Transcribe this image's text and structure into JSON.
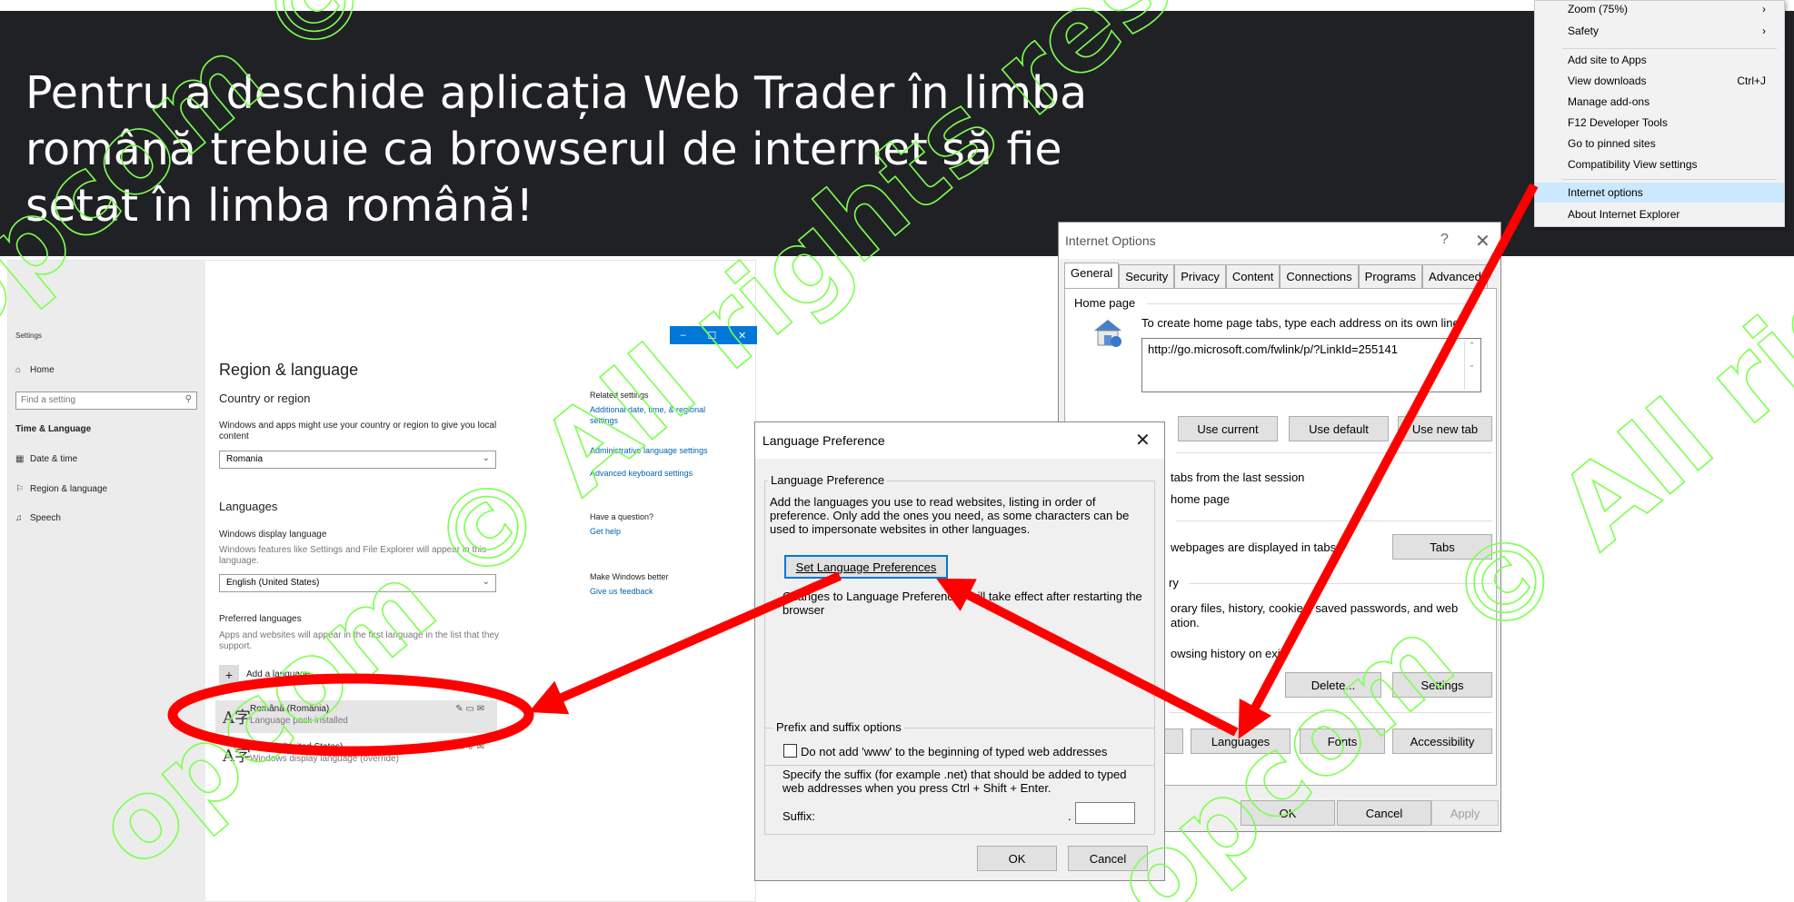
{
  "headline": {
    "line1": "Pentru a deschide aplicația  Web Trader în limba",
    "line2": "română  trebuie ca browserul de internet să fie",
    "line3": "setat în limba română!"
  },
  "settings": {
    "window_title": "Settings",
    "sidebar": {
      "home": "Home",
      "search_placeholder": "Find a setting",
      "section": "Time & Language",
      "items": [
        "Date & time",
        "Region & language",
        "Speech"
      ]
    },
    "window_buttons": {
      "minimize": "–",
      "maximize": "☐",
      "close": "✕"
    },
    "page_title": "Region & language",
    "country_heading": "Country or region",
    "country_desc": "Windows and apps might use your country or region to give you local content",
    "country_value": "Romania",
    "languages_heading": "Languages",
    "display_language_label": "Windows display language",
    "display_language_desc": "Windows features like Settings and File Explorer will appear in this language.",
    "display_language_value": "English (United States)",
    "preferred_label": "Preferred languages",
    "preferred_desc": "Apps and websites will appear in the first language in the list that they support.",
    "add_language": "Add a language",
    "languages": [
      {
        "name": "Română (România)",
        "status": "Language pack installed"
      },
      {
        "name": "English (United States)",
        "status": "Windows display language (override)"
      }
    ],
    "related": {
      "heading": "Related settings",
      "links": [
        "Additional date, time, & regional settings",
        "Administrative language settings",
        "Advanced keyboard settings"
      ],
      "question": "Have a question?",
      "get_help": "Get help",
      "better": "Make Windows better",
      "feedback": "Give us feedback"
    }
  },
  "language_dialog": {
    "title": "Language Preference",
    "group1": "Language Preference",
    "desc": "Add the languages you use to read websites, listing in order of preference. Only add the ones you need, as some characters can be used to impersonate websites in other languages.",
    "set_button": "Set Language Preferences",
    "note": "Changes to Language Preferences will take effect after restarting the browser",
    "group2": "Prefix and suffix options",
    "checkbox": "Do not add 'www' to the beginning of typed web addresses",
    "suffix_desc": "Specify the suffix (for example .net) that should be added to typed web addresses when you press Ctrl + Shift + Enter.",
    "suffix_label": "Suffix:",
    "suffix_dot": ".",
    "ok": "OK",
    "cancel": "Cancel"
  },
  "internet_options": {
    "title": "Internet Options",
    "help": "?",
    "close": "✕",
    "tabs": [
      "General",
      "Security",
      "Privacy",
      "Content",
      "Connections",
      "Programs",
      "Advanced"
    ],
    "home_page_label": "Home page",
    "home_page_desc": "To create home page tabs, type each address on its own line.",
    "home_page_url": "http://go.microsoft.com/fwlink/p/?LinkId=255141",
    "use_current": "Use current",
    "use_default": "Use default",
    "use_new_tab": "Use new tab",
    "startup_session": "tabs from the last session",
    "startup_home": "home page",
    "tabs_desc": "webpages are displayed in tabs.",
    "tabs_button": "Tabs",
    "history_label": "ry",
    "history_desc1": "orary files, history, cookies, saved passwords, and web",
    "history_desc2": "ation.",
    "history_exit": "owsing history on exit",
    "delete": "Delete...",
    "settings": "Settings",
    "languages": "Languages",
    "fonts": "Fonts",
    "accessibility": "Accessibility",
    "ok": "OK",
    "cancel": "Cancel",
    "apply": "Apply"
  },
  "ie_menu": {
    "items": [
      {
        "label": "Zoom (75%)",
        "shortcut": "›"
      },
      {
        "label": "Safety",
        "shortcut": "›"
      },
      {
        "label": "Add site to Apps",
        "shortcut": ""
      },
      {
        "label": "View downloads",
        "shortcut": "Ctrl+J"
      },
      {
        "label": "Manage add-ons",
        "shortcut": ""
      },
      {
        "label": "F12 Developer Tools",
        "shortcut": ""
      },
      {
        "label": "Go to pinned sites",
        "shortcut": ""
      },
      {
        "label": "Compatibility View settings",
        "shortcut": ""
      },
      {
        "label": "Internet options",
        "shortcut": ""
      },
      {
        "label": "About Internet Explorer",
        "shortcut": ""
      }
    ],
    "highlighted": "Internet options"
  },
  "watermark": {
    "text": "opcom © All rights reserved",
    "color": "#7dff50"
  },
  "colors": {
    "arrow": "#ff0000",
    "highlight_ring": "#ff0000",
    "accent": "#0078d7"
  },
  "icons": [
    "home-icon",
    "search-icon",
    "calendar-icon",
    "region-icon",
    "microphone-icon",
    "house-globe-icon",
    "language-glyph-icon"
  ]
}
